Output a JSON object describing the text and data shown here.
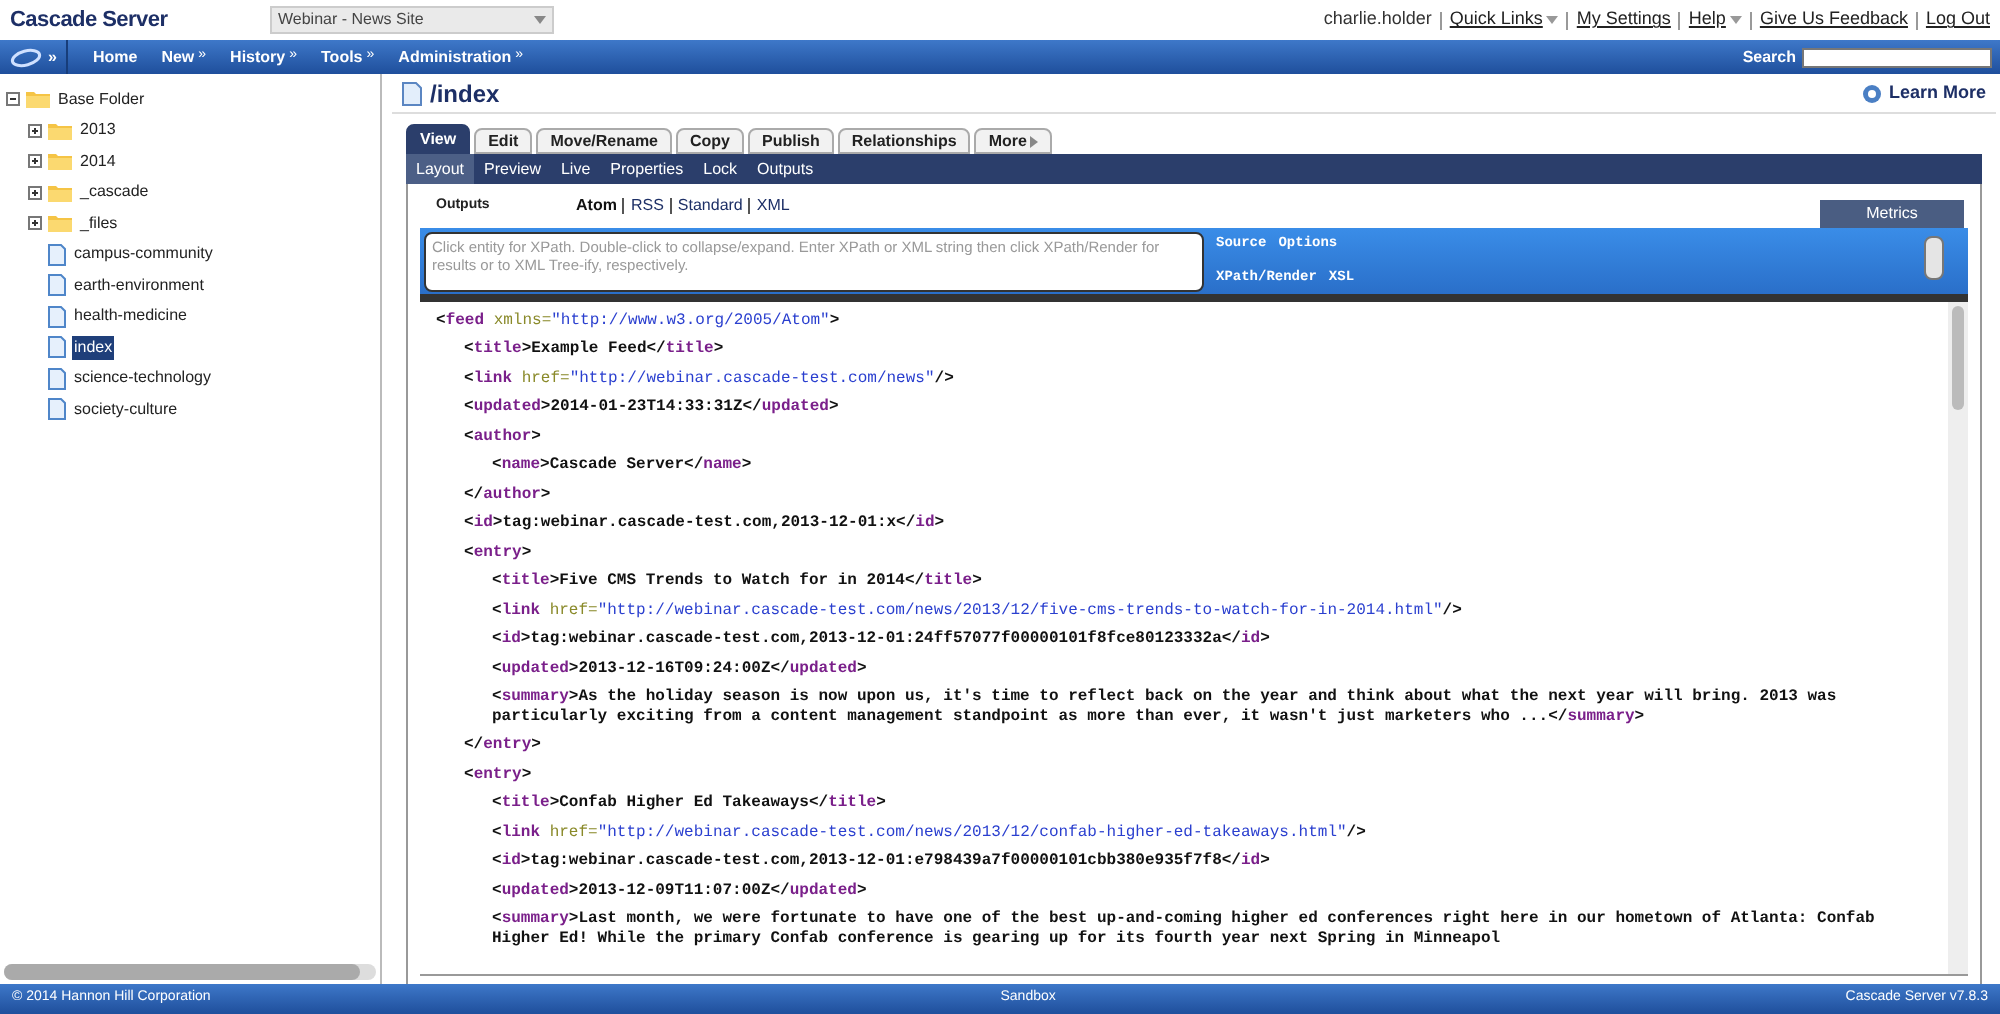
{
  "header": {
    "logo": "Cascade Server",
    "site_select": "Webinar - News Site",
    "user": "charlie.holder",
    "links": [
      {
        "label": "Quick Links",
        "dropdown": true
      },
      {
        "label": "My Settings",
        "dropdown": false
      },
      {
        "label": "Help",
        "dropdown": true
      },
      {
        "label": "Give Us Feedback",
        "dropdown": false
      },
      {
        "label": "Log Out",
        "dropdown": false
      }
    ]
  },
  "nav": {
    "menu_glyph": "»",
    "items": [
      {
        "label": "Home",
        "dropdown": false
      },
      {
        "label": "New",
        "dropdown": true
      },
      {
        "label": "History",
        "dropdown": true
      },
      {
        "label": "Tools",
        "dropdown": true
      },
      {
        "label": "Administration",
        "dropdown": true
      }
    ],
    "dropdown_glyph": "»",
    "search_label": "Search"
  },
  "tree": [
    {
      "label": "Base Folder",
      "kind": "folder",
      "expanded": true,
      "selected": false,
      "children": [
        {
          "label": "2013",
          "kind": "folder",
          "expanded": false,
          "selected": false
        },
        {
          "label": "2014",
          "kind": "folder",
          "expanded": false,
          "selected": false
        },
        {
          "label": "_cascade",
          "kind": "folder",
          "expanded": false,
          "selected": false
        },
        {
          "label": "_files",
          "kind": "folder",
          "expanded": false,
          "selected": false
        },
        {
          "label": "campus-community",
          "kind": "page",
          "selected": false
        },
        {
          "label": "earth-environment",
          "kind": "page",
          "selected": false
        },
        {
          "label": "health-medicine",
          "kind": "page",
          "selected": false
        },
        {
          "label": "index",
          "kind": "page",
          "selected": true
        },
        {
          "label": "science-technology",
          "kind": "page",
          "selected": false
        },
        {
          "label": "society-culture",
          "kind": "page",
          "selected": false
        }
      ]
    }
  ],
  "page": {
    "title": "/index",
    "learn_more": "Learn More",
    "tabs": [
      {
        "label": "View",
        "selected": true
      },
      {
        "label": "Edit",
        "selected": false
      },
      {
        "label": "Move/Rename",
        "selected": false
      },
      {
        "label": "Copy",
        "selected": false
      },
      {
        "label": "Publish",
        "selected": false
      },
      {
        "label": "Relationships",
        "selected": false
      },
      {
        "label": "More",
        "selected": false
      }
    ],
    "subtabs": [
      {
        "label": "Layout",
        "selected": true
      },
      {
        "label": "Preview",
        "selected": false
      },
      {
        "label": "Live",
        "selected": false
      },
      {
        "label": "Properties",
        "selected": false
      },
      {
        "label": "Lock",
        "selected": false
      },
      {
        "label": "Outputs",
        "selected": false
      }
    ],
    "outputs_label": "Outputs",
    "outputs": [
      {
        "label": "Atom",
        "selected": true
      },
      {
        "label": "RSS",
        "selected": false
      },
      {
        "label": "Standard",
        "selected": false
      },
      {
        "label": "XML",
        "selected": false
      }
    ],
    "metrics_tab": "Metrics",
    "xpath": {
      "placeholder": "Click entity for XPath. Double-click to collapse/expand. Enter XPath or XML string then click XPath/Render for results or to XML Tree-ify, respectively.",
      "links_top": [
        "Source",
        "Options"
      ],
      "links_bottom": [
        "XPath/Render",
        "XSL"
      ]
    },
    "xml": [
      {
        "parts": [
          {
            "kind": "punct",
            "text": "<"
          },
          {
            "kind": "tag",
            "text": "feed"
          },
          {
            "kind": "attr",
            "text": " xmlns="
          },
          {
            "kind": "value",
            "text": "\"http://www.w3.org/2005/Atom\""
          },
          {
            "kind": "punct",
            "text": ">"
          }
        ],
        "children": [
          {
            "parts": [
              {
                "kind": "punct",
                "text": "<"
              },
              {
                "kind": "tag",
                "text": "title"
              },
              {
                "kind": "punct",
                "text": ">Example Feed</"
              },
              {
                "kind": "tag",
                "text": "title"
              },
              {
                "kind": "punct",
                "text": ">"
              }
            ]
          },
          {
            "parts": [
              {
                "kind": "punct",
                "text": "<"
              },
              {
                "kind": "tag",
                "text": "link"
              },
              {
                "kind": "attr",
                "text": " href="
              },
              {
                "kind": "value",
                "text": "\"http://webinar.cascade-test.com/news\""
              },
              {
                "kind": "punct",
                "text": "/>"
              }
            ]
          },
          {
            "parts": [
              {
                "kind": "punct",
                "text": "<"
              },
              {
                "kind": "tag",
                "text": "updated"
              },
              {
                "kind": "punct",
                "text": ">2014-01-23T14:33:31Z</"
              },
              {
                "kind": "tag",
                "text": "updated"
              },
              {
                "kind": "punct",
                "text": ">"
              }
            ]
          },
          {
            "parts": [
              {
                "kind": "punct",
                "text": "<"
              },
              {
                "kind": "tag",
                "text": "author"
              },
              {
                "kind": "punct",
                "text": ">"
              }
            ],
            "children": [
              {
                "parts": [
                  {
                    "kind": "punct",
                    "text": "<"
                  },
                  {
                    "kind": "tag",
                    "text": "name"
                  },
                  {
                    "kind": "punct",
                    "text": ">Cascade Server</"
                  },
                  {
                    "kind": "tag",
                    "text": "name"
                  },
                  {
                    "kind": "punct",
                    "text": ">"
                  }
                ]
              }
            ],
            "close": [
              {
                "kind": "punct",
                "text": "</"
              },
              {
                "kind": "tag",
                "text": "author"
              },
              {
                "kind": "punct",
                "text": ">"
              }
            ]
          },
          {
            "parts": [
              {
                "kind": "punct",
                "text": "<"
              },
              {
                "kind": "tag",
                "text": "id"
              },
              {
                "kind": "punct",
                "text": ">tag:webinar.cascade-test.com,2013-12-01:x</"
              },
              {
                "kind": "tag",
                "text": "id"
              },
              {
                "kind": "punct",
                "text": ">"
              }
            ]
          },
          {
            "parts": [
              {
                "kind": "punct",
                "text": "<"
              },
              {
                "kind": "tag",
                "text": "entry"
              },
              {
                "kind": "punct",
                "text": ">"
              }
            ],
            "children": [
              {
                "parts": [
                  {
                    "kind": "punct",
                    "text": "<"
                  },
                  {
                    "kind": "tag",
                    "text": "title"
                  },
                  {
                    "kind": "punct",
                    "text": ">Five CMS Trends to Watch for in 2014</"
                  },
                  {
                    "kind": "tag",
                    "text": "title"
                  },
                  {
                    "kind": "punct",
                    "text": ">"
                  }
                ]
              },
              {
                "parts": [
                  {
                    "kind": "punct",
                    "text": "<"
                  },
                  {
                    "kind": "tag",
                    "text": "link"
                  },
                  {
                    "kind": "attr",
                    "text": " href="
                  },
                  {
                    "kind": "value",
                    "text": "\"http://webinar.cascade-test.com/news/2013/12/five-cms-trends-to-watch-for-in-2014.html\""
                  },
                  {
                    "kind": "punct",
                    "text": "/>"
                  }
                ]
              },
              {
                "parts": [
                  {
                    "kind": "punct",
                    "text": "<"
                  },
                  {
                    "kind": "tag",
                    "text": "id"
                  },
                  {
                    "kind": "punct",
                    "text": ">tag:webinar.cascade-test.com,2013-12-01:24ff57077f00000101f8fce80123332a</"
                  },
                  {
                    "kind": "tag",
                    "text": "id"
                  },
                  {
                    "kind": "punct",
                    "text": ">"
                  }
                ]
              },
              {
                "parts": [
                  {
                    "kind": "punct",
                    "text": "<"
                  },
                  {
                    "kind": "tag",
                    "text": "updated"
                  },
                  {
                    "kind": "punct",
                    "text": ">2013-12-16T09:24:00Z</"
                  },
                  {
                    "kind": "tag",
                    "text": "updated"
                  },
                  {
                    "kind": "punct",
                    "text": ">"
                  }
                ]
              },
              {
                "parts": [
                  {
                    "kind": "punct",
                    "text": "<"
                  },
                  {
                    "kind": "tag",
                    "text": "summary"
                  },
                  {
                    "kind": "punct",
                    "text": ">As the holiday season is now upon us, it's time to reflect back on the year and think about what the next year will bring. 2013 was particularly exciting from a content management standpoint as more than ever, it wasn't just marketers who ...</"
                  },
                  {
                    "kind": "tag",
                    "text": "summary"
                  },
                  {
                    "kind": "punct",
                    "text": ">"
                  }
                ]
              }
            ],
            "close": [
              {
                "kind": "punct",
                "text": "</"
              },
              {
                "kind": "tag",
                "text": "entry"
              },
              {
                "kind": "punct",
                "text": ">"
              }
            ]
          },
          {
            "parts": [
              {
                "kind": "punct",
                "text": "<"
              },
              {
                "kind": "tag",
                "text": "entry"
              },
              {
                "kind": "punct",
                "text": ">"
              }
            ],
            "children": [
              {
                "parts": [
                  {
                    "kind": "punct",
                    "text": "<"
                  },
                  {
                    "kind": "tag",
                    "text": "title"
                  },
                  {
                    "kind": "punct",
                    "text": ">Confab Higher Ed Takeaways</"
                  },
                  {
                    "kind": "tag",
                    "text": "title"
                  },
                  {
                    "kind": "punct",
                    "text": ">"
                  }
                ]
              },
              {
                "parts": [
                  {
                    "kind": "punct",
                    "text": "<"
                  },
                  {
                    "kind": "tag",
                    "text": "link"
                  },
                  {
                    "kind": "attr",
                    "text": " href="
                  },
                  {
                    "kind": "value",
                    "text": "\"http://webinar.cascade-test.com/news/2013/12/confab-higher-ed-takeaways.html\""
                  },
                  {
                    "kind": "punct",
                    "text": "/>"
                  }
                ]
              },
              {
                "parts": [
                  {
                    "kind": "punct",
                    "text": "<"
                  },
                  {
                    "kind": "tag",
                    "text": "id"
                  },
                  {
                    "kind": "punct",
                    "text": ">tag:webinar.cascade-test.com,2013-12-01:e798439a7f00000101cbb380e935f7f8</"
                  },
                  {
                    "kind": "tag",
                    "text": "id"
                  },
                  {
                    "kind": "punct",
                    "text": ">"
                  }
                ]
              },
              {
                "parts": [
                  {
                    "kind": "punct",
                    "text": "<"
                  },
                  {
                    "kind": "tag",
                    "text": "updated"
                  },
                  {
                    "kind": "punct",
                    "text": ">2013-12-09T11:07:00Z</"
                  },
                  {
                    "kind": "tag",
                    "text": "updated"
                  },
                  {
                    "kind": "punct",
                    "text": ">"
                  }
                ]
              },
              {
                "parts": [
                  {
                    "kind": "punct",
                    "text": "<"
                  },
                  {
                    "kind": "tag",
                    "text": "summary"
                  },
                  {
                    "kind": "punct",
                    "text": ">Last month, we were fortunate to have one of the best up-and-coming higher ed conferences right here in our hometown of Atlanta: Confab Higher Ed! While the primary Confab conference is gearing up for its fourth year next Spring in Minneapol"
                  }
                ]
              }
            ]
          }
        ]
      }
    ]
  },
  "footer": {
    "copyright": "© 2014 Hannon Hill Corporation",
    "center": "Sandbox",
    "version": "Cascade Server v7.8.3"
  }
}
